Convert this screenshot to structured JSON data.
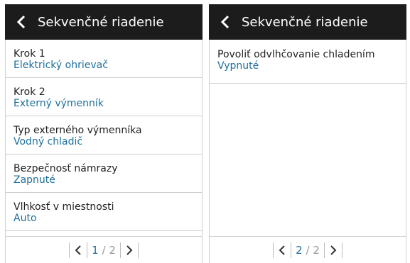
{
  "left_screen": {
    "title": "Sekvenčné riadenie",
    "items": [
      {
        "label": "Krok 1",
        "value": "Elektrický ohrievač"
      },
      {
        "label": "Krok 2",
        "value": "Externý výmenník"
      },
      {
        "label": "Typ externého výmenníka",
        "value": "Vodný chladič"
      },
      {
        "label": "Bezpečnosť námrazy",
        "value": "Zapnuté"
      },
      {
        "label": "Vlhkosť v miestnosti",
        "value": "Auto"
      }
    ],
    "pager": {
      "current": "1",
      "separator": "/",
      "total": "2"
    }
  },
  "right_screen": {
    "title": "Sekvenčné riadenie",
    "items": [
      {
        "label": "Povoliť odvlhčovanie chladením",
        "value": "Vypnuté"
      }
    ],
    "pager": {
      "current": "2",
      "separator": "/",
      "total": "2"
    }
  },
  "icons": {
    "back": "chevron-left-icon",
    "prev": "chevron-left-icon",
    "next": "chevron-right-icon"
  },
  "colors": {
    "header_bg": "#1c1c1c",
    "value_text": "#1f6f9c",
    "divider": "#cfcfcf"
  }
}
